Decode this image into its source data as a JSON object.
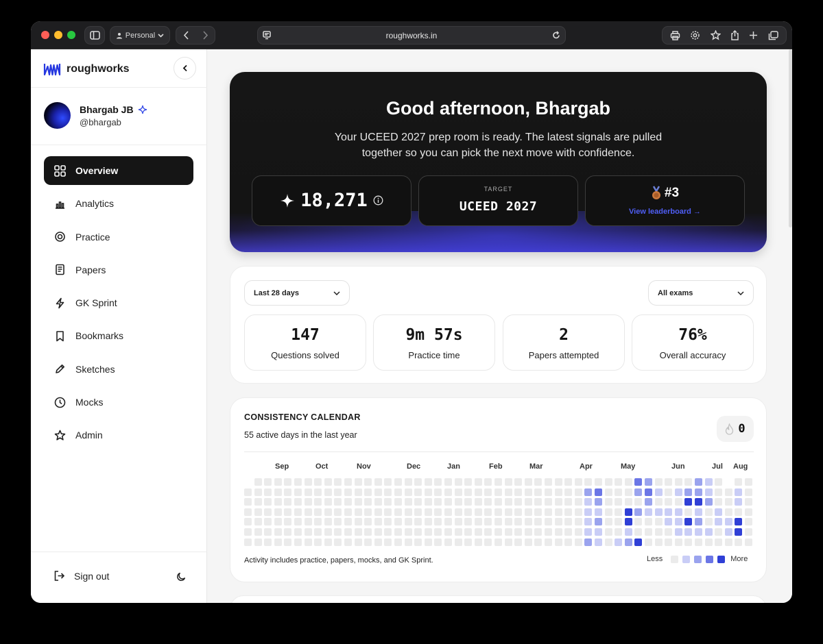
{
  "browser": {
    "profile_label": "Personal",
    "url": "roughworks.in"
  },
  "sidebar": {
    "brand": "roughworks",
    "user": {
      "name": "Bhargab JB",
      "handle": "@bhargab"
    },
    "items": [
      {
        "label": "Overview",
        "icon": "grid-icon",
        "active": true
      },
      {
        "label": "Analytics",
        "icon": "bar-chart-icon"
      },
      {
        "label": "Practice",
        "icon": "target-icon"
      },
      {
        "label": "Papers",
        "icon": "document-icon"
      },
      {
        "label": "GK Sprint",
        "icon": "zap-icon"
      },
      {
        "label": "Bookmarks",
        "icon": "bookmark-icon"
      },
      {
        "label": "Sketches",
        "icon": "pencil-icon"
      },
      {
        "label": "Mocks",
        "icon": "clock-icon"
      },
      {
        "label": "Admin",
        "icon": "star-icon"
      }
    ],
    "sign_out": "Sign out"
  },
  "hero": {
    "title": "Good afternoon, Bhargab",
    "subtitle": "Your UCEED 2027 prep room is ready. The latest signals are pulled together so you can pick the next move with confidence.",
    "points": "18,271",
    "target_label": "TARGET",
    "target_value": "UCEED 2027",
    "rank": "#3",
    "leaderboard_link": "View leaderboard →"
  },
  "filters": {
    "period": "Last 28 days",
    "exam": "All exams"
  },
  "metrics": [
    {
      "value": "147",
      "label": "Questions solved"
    },
    {
      "value": "9m 57s",
      "label": "Practice time"
    },
    {
      "value": "2",
      "label": "Papers attempted"
    },
    {
      "value": "76%",
      "label": "Overall accuracy"
    }
  ],
  "calendar": {
    "title": "CONSISTENCY CALENDAR",
    "subtitle": "55 active days in the last year",
    "streak": "0",
    "months": [
      "Sep",
      "Oct",
      "Nov",
      "Dec",
      "Jan",
      "Feb",
      "Mar",
      "Apr",
      "May",
      "Jun",
      "Jul",
      "Aug"
    ],
    "footnote": "Activity includes practice, papers, mocks, and GK Sprint.",
    "legend_less": "Less",
    "legend_more": "More",
    "colors": [
      "#ebebeb",
      "#c9cdf6",
      "#9aa3ee",
      "#6b76e6",
      "#2f3fd6"
    ],
    "active_cells": [
      [
        34,
        1,
        2
      ],
      [
        34,
        2,
        1
      ],
      [
        34,
        3,
        1
      ],
      [
        34,
        4,
        1
      ],
      [
        34,
        5,
        1
      ],
      [
        34,
        6,
        2
      ],
      [
        35,
        1,
        3
      ],
      [
        35,
        2,
        2
      ],
      [
        35,
        3,
        1
      ],
      [
        35,
        4,
        2
      ],
      [
        35,
        5,
        1
      ],
      [
        35,
        6,
        1
      ],
      [
        37,
        6,
        1
      ],
      [
        38,
        3,
        4
      ],
      [
        38,
        4,
        4
      ],
      [
        38,
        5,
        1
      ],
      [
        38,
        6,
        2
      ],
      [
        39,
        0,
        3
      ],
      [
        39,
        1,
        2
      ],
      [
        39,
        3,
        2
      ],
      [
        39,
        6,
        4
      ],
      [
        40,
        0,
        2
      ],
      [
        40,
        1,
        3
      ],
      [
        40,
        2,
        2
      ],
      [
        40,
        3,
        1
      ],
      [
        41,
        1,
        1
      ],
      [
        41,
        3,
        1
      ],
      [
        42,
        3,
        1
      ],
      [
        42,
        4,
        1
      ],
      [
        43,
        1,
        1
      ],
      [
        43,
        3,
        1
      ],
      [
        43,
        4,
        1
      ],
      [
        43,
        5,
        1
      ],
      [
        44,
        1,
        2
      ],
      [
        44,
        2,
        4
      ],
      [
        44,
        4,
        4
      ],
      [
        44,
        5,
        1
      ],
      [
        45,
        0,
        2
      ],
      [
        45,
        1,
        2
      ],
      [
        45,
        2,
        4
      ],
      [
        45,
        3,
        1
      ],
      [
        45,
        4,
        2
      ],
      [
        45,
        5,
        1
      ],
      [
        46,
        0,
        1
      ],
      [
        46,
        1,
        1
      ],
      [
        46,
        2,
        2
      ],
      [
        46,
        5,
        1
      ],
      [
        47,
        3,
        1
      ],
      [
        47,
        4,
        1
      ],
      [
        48,
        0,
        5
      ],
      [
        48,
        4,
        1
      ],
      [
        48,
        5,
        1
      ],
      [
        49,
        1,
        1
      ],
      [
        49,
        2,
        1
      ],
      [
        49,
        4,
        4
      ],
      [
        49,
        5,
        4
      ]
    ]
  }
}
